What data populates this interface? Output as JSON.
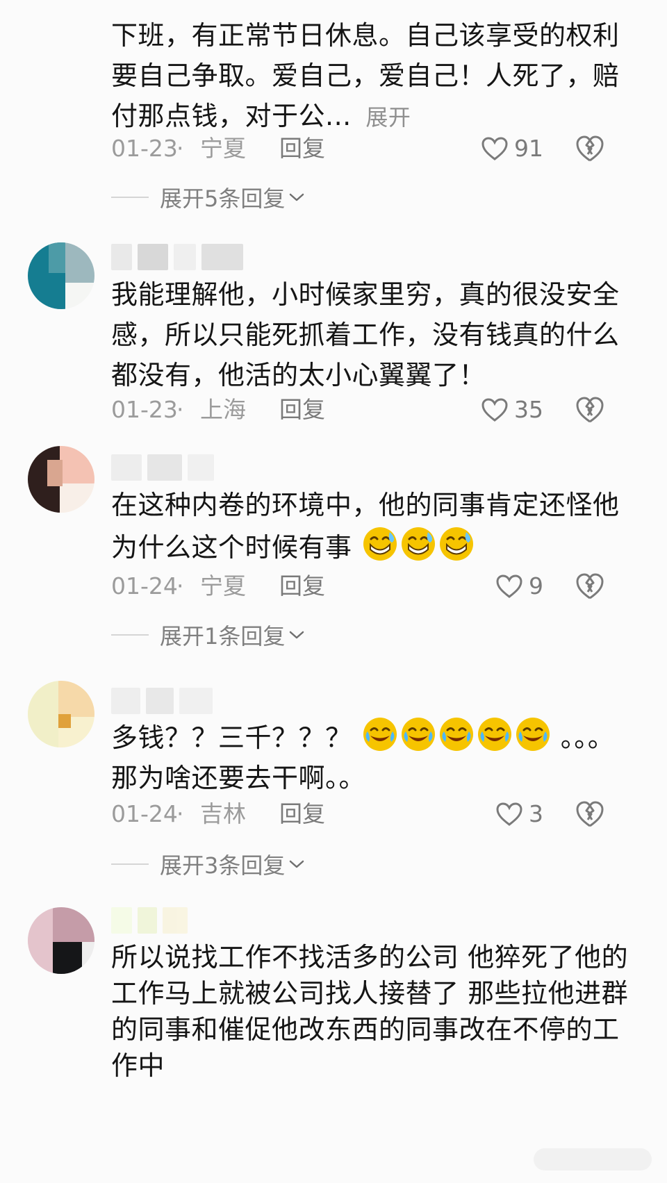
{
  "comments": [
    {
      "text": "下班，有正常节日休息。自己该享受的权利要自己争取。爱自己，爱自己！人死了，赔付那点钱，对于公...",
      "expand_label": "展开",
      "date": "01-23",
      "dot": "·",
      "location": "宁夏",
      "reply_label": "回复",
      "likes": "91",
      "expand_replies_label": "展开5条回复"
    },
    {
      "text": "我能理解他，小时候家里穷，真的很没安全感，所以只能死抓着工作，没有钱真的什么都没有，他活的太小心翼翼了！",
      "date": "01-23",
      "dot": "·",
      "location": "上海",
      "reply_label": "回复",
      "likes": "35"
    },
    {
      "text": "在这种内卷的环境中，他的同事肯定还怪他为什么这个时候有事",
      "date": "01-24",
      "dot": "·",
      "location": "宁夏",
      "reply_label": "回复",
      "likes": "9",
      "expand_replies_label": "展开1条回复"
    },
    {
      "text": "多钱？？三千？？？",
      "text_2": "。。。",
      "text_3": "那为啥还要去干啊。。",
      "date": "01-24",
      "dot": "·",
      "location": "吉林",
      "reply_label": "回复",
      "likes": "3",
      "expand_replies_label": "展开3条回复"
    },
    {
      "text": "所以说找工作不找活多的公司 他猝死了他的工作马上就被公司找人接替了 那些拉他进群的同事和催促他改东西的同事改在不停的工作中"
    }
  ],
  "icons": {
    "like": "heart-outline-icon",
    "dislike": "broken-heart-icon",
    "expand": "chevron-down-icon",
    "emoji": "grinning-sweat-emoji-icon",
    "crying": "crying-laughing-emoji-icon"
  },
  "colors": {
    "text": "#151515",
    "meta": "#9b9b9b",
    "muted": "#7a7a7a",
    "background": "#fbfbfb",
    "emoji_yellow": "#f6c400"
  }
}
